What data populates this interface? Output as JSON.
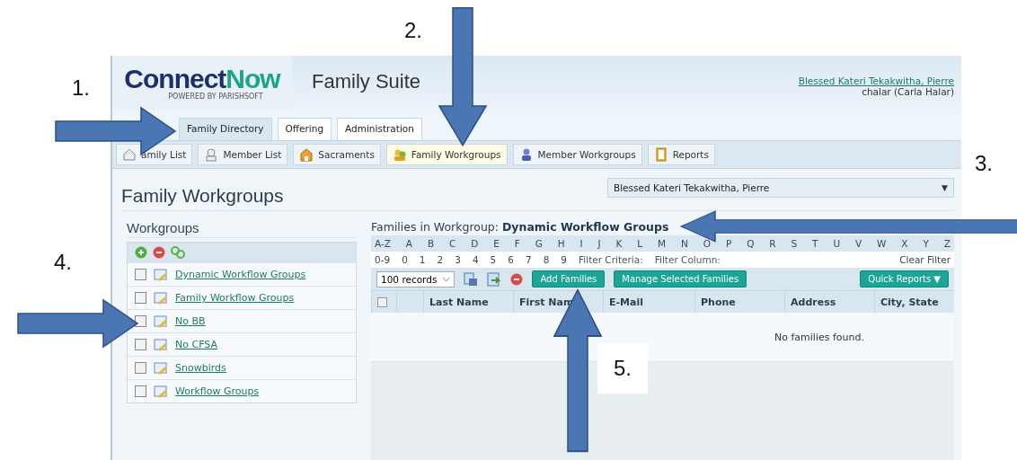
{
  "logo": {
    "word_1": "Connect",
    "word_2": "Now",
    "tagline": "POWERED BY PARISHSOFT"
  },
  "suite_title": "Family Suite",
  "user": {
    "parish": "Blessed Kateri Tekakwitha, Pierre",
    "login": "chalar (Carla Halar)"
  },
  "tabs": [
    {
      "label": "Family Directory",
      "selected": true
    },
    {
      "label": "Offering",
      "selected": false
    },
    {
      "label": "Administration",
      "selected": false
    }
  ],
  "subnav": [
    {
      "label": "amily List",
      "selected": false
    },
    {
      "label": "Member List",
      "selected": false
    },
    {
      "label": "Sacraments",
      "selected": false
    },
    {
      "label": "Family Workgroups",
      "selected": true
    },
    {
      "label": "Member Workgroups",
      "selected": false
    },
    {
      "label": "Reports",
      "selected": false
    }
  ],
  "page_title": "Family Workgroups",
  "parish_select": {
    "value": "Blessed Kateri Tekakwitha, Pierre",
    "caret": "▼"
  },
  "workgroups": {
    "title": "Workgroups",
    "items": [
      {
        "name": "Dynamic Workflow Groups",
        "checked": false
      },
      {
        "name": "Family Workflow Groups",
        "checked": false
      },
      {
        "name": "No BB",
        "checked": false
      },
      {
        "name": "No CFSA",
        "checked": false
      },
      {
        "name": "Snowbirds",
        "checked": false
      },
      {
        "name": "Workflow Groups",
        "checked": false
      }
    ]
  },
  "families": {
    "heading": "Families in Workgroup: **Dynamic Workflow Groups**",
    "letters": [
      "A-Z",
      "A",
      "B",
      "C",
      "D",
      "E",
      "F",
      "G",
      "H",
      "I",
      "J",
      "K",
      "L",
      "M",
      "N",
      "O",
      "P",
      "Q",
      "R",
      "S",
      "T",
      "U",
      "V",
      "W",
      "X",
      "Y",
      "Z"
    ],
    "digits": [
      "0-9",
      "0",
      "1",
      "2",
      "3",
      "4",
      "5",
      "6",
      "7",
      "8",
      "9"
    ],
    "filter_criteria": "Filter Criteria:",
    "filter_column": "Filter Column:",
    "clear_filter": "Clear Filter",
    "records": "100 records",
    "select_all_checked": false,
    "add_button": "Add Families",
    "manage_button": "Manage Selected Families",
    "reports_button": "Quick Reports ▼",
    "columns": [
      "Last Name",
      "First Nam",
      "E-Mail",
      "Phone",
      "Address",
      "City, State"
    ],
    "empty_message": "No families found."
  },
  "annotations": [
    {
      "label": "1.",
      "kind": "right"
    },
    {
      "label": "2.",
      "kind": "down"
    },
    {
      "label": "3.",
      "kind": "left"
    },
    {
      "label": "4.",
      "kind": "right"
    },
    {
      "label": "5.",
      "kind": "up"
    }
  ]
}
